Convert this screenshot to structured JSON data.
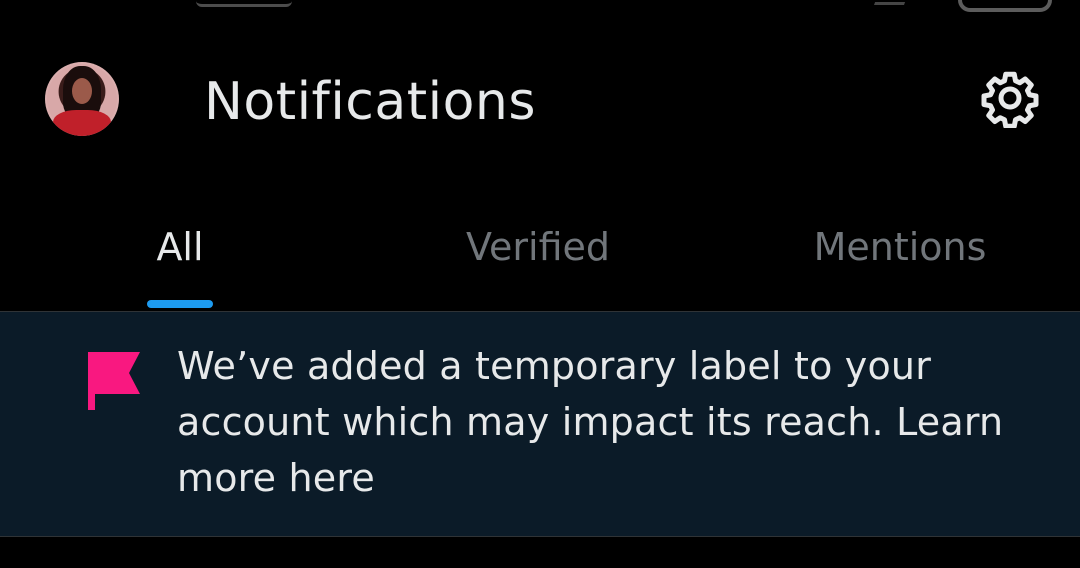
{
  "header": {
    "title": "Notifications",
    "avatar_icon": "profile-avatar",
    "settings_icon": "gear-icon"
  },
  "tabs": [
    {
      "label": "All",
      "active": true
    },
    {
      "label": "Verified",
      "active": false
    },
    {
      "label": "Mentions",
      "active": false
    }
  ],
  "notice": {
    "icon": "flag-icon",
    "icon_color": "#f91880",
    "text": "We’ve added a temporary label to your account which may impact its reach. Learn more here"
  },
  "colors": {
    "background": "#000000",
    "accent": "#1d9bf0",
    "notice_background": "#0b1b28",
    "primary_text": "#e7e9ea",
    "secondary_text": "#71767b"
  }
}
